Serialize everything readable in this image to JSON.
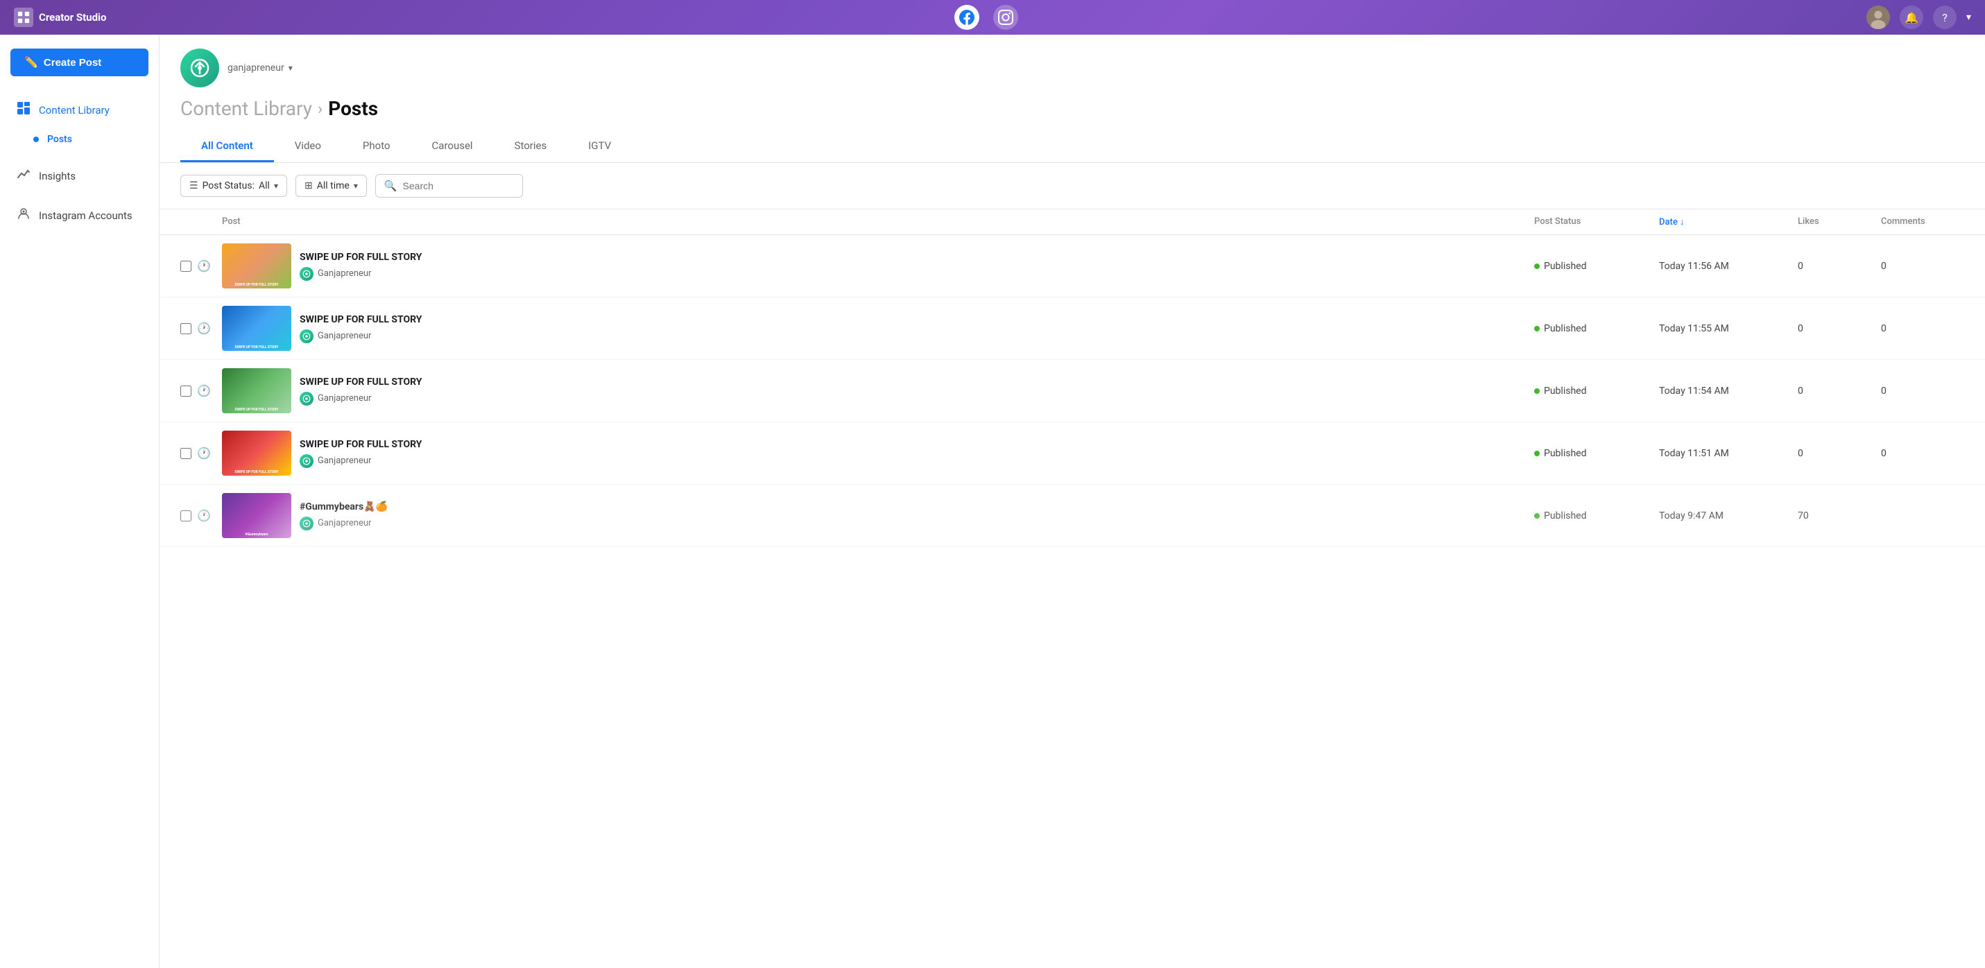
{
  "app": {
    "brand": "Creator Studio",
    "brand_icon": "▦"
  },
  "header": {
    "account_name": "ganjapreneur",
    "breadcrumb_parent": "Content Library",
    "breadcrumb_child": "Posts"
  },
  "tabs": [
    {
      "id": "all",
      "label": "All Content",
      "active": true
    },
    {
      "id": "video",
      "label": "Video",
      "active": false
    },
    {
      "id": "photo",
      "label": "Photo",
      "active": false
    },
    {
      "id": "carousel",
      "label": "Carousel",
      "active": false
    },
    {
      "id": "stories",
      "label": "Stories",
      "active": false
    },
    {
      "id": "igtv",
      "label": "IGTV",
      "active": false
    }
  ],
  "toolbar": {
    "post_status_label": "Post Status:",
    "post_status_value": "All",
    "time_filter_label": "All time",
    "search_placeholder": "Search"
  },
  "table": {
    "columns": [
      {
        "id": "select",
        "label": ""
      },
      {
        "id": "post",
        "label": "Post"
      },
      {
        "id": "status",
        "label": "Post Status"
      },
      {
        "id": "date",
        "label": "Date ↓",
        "sortable": true
      },
      {
        "id": "likes",
        "label": "Likes"
      },
      {
        "id": "comments",
        "label": "Comments"
      }
    ],
    "rows": [
      {
        "id": 1,
        "title": "SWIPE UP FOR FULL STORY",
        "account": "Ganjapreneur",
        "status": "Published",
        "date": "Today 11:56 AM",
        "likes": "0",
        "comments": "0",
        "thumb_class": "thumb-1"
      },
      {
        "id": 2,
        "title": "SWIPE UP FOR FULL STORY",
        "account": "Ganjapreneur",
        "status": "Published",
        "date": "Today 11:55 AM",
        "likes": "0",
        "comments": "0",
        "thumb_class": "thumb-2"
      },
      {
        "id": 3,
        "title": "SWIPE UP FOR FULL STORY",
        "account": "Ganjapreneur",
        "status": "Published",
        "date": "Today 11:54 AM",
        "likes": "0",
        "comments": "0",
        "thumb_class": "thumb-3"
      },
      {
        "id": 4,
        "title": "SWIPE UP FOR FULL STORY",
        "account": "Ganjapreneur",
        "status": "Published",
        "date": "Today 11:51 AM",
        "likes": "0",
        "comments": "0",
        "thumb_class": "thumb-4"
      },
      {
        "id": 5,
        "title": "#Gummybears🧸🍊",
        "account": "Ganjapreneur",
        "status": "Published",
        "date": "Today 9:47 AM",
        "likes": "70",
        "comments": "",
        "thumb_class": "thumb-partial"
      }
    ]
  },
  "sidebar": {
    "create_post_label": "Create Post",
    "items": [
      {
        "id": "content-library",
        "label": "Content Library",
        "icon": "⊞",
        "active": true
      },
      {
        "id": "posts",
        "label": "Posts",
        "sub": true,
        "active": true
      },
      {
        "id": "insights",
        "label": "Insights",
        "icon": "↗",
        "active": false
      },
      {
        "id": "instagram-accounts",
        "label": "Instagram Accounts",
        "icon": "👤",
        "active": false
      }
    ]
  }
}
